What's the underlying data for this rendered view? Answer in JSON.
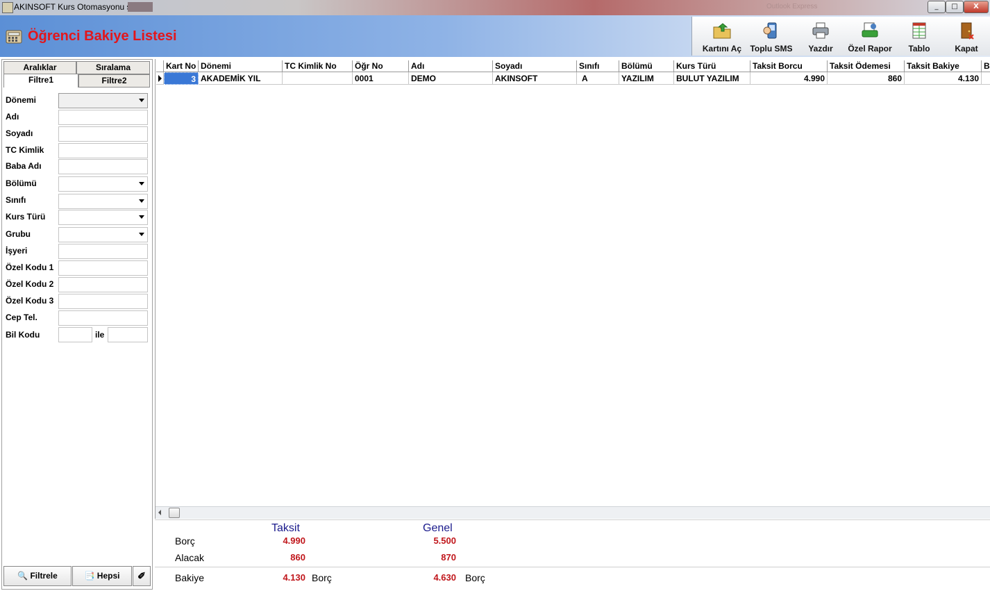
{
  "window": {
    "title": "AKINSOFT Kurs Otomasyonu s",
    "bg_label": "Outlook Express",
    "minimize": "_",
    "maximize": "□",
    "close": "X"
  },
  "header": {
    "title": "Öğrenci Bakiye Listesi",
    "title_color": "#e3161b"
  },
  "toolbar": {
    "items": [
      {
        "label": "Kartını Aç",
        "icon": "folder-open-icon"
      },
      {
        "label": "Toplu SMS",
        "icon": "sms-icon"
      },
      {
        "label": "Yazdır",
        "icon": "printer-icon"
      },
      {
        "label": "Özel Rapor",
        "icon": "report-icon"
      },
      {
        "label": "Tablo",
        "icon": "table-icon"
      },
      {
        "label": "Kapat",
        "icon": "door-exit-icon"
      }
    ]
  },
  "left_panel": {
    "tabs_top": [
      "Aralıklar",
      "Sıralama"
    ],
    "tabs_bottom": [
      "Filtre1",
      "Filtre2"
    ],
    "fields": [
      {
        "label": "Dönemi",
        "type": "combo",
        "value": ""
      },
      {
        "label": "Adı",
        "type": "text",
        "value": ""
      },
      {
        "label": "Soyadı",
        "type": "text",
        "value": ""
      },
      {
        "label": "TC Kimlik",
        "type": "text",
        "value": ""
      },
      {
        "label": "Baba Adı",
        "type": "text",
        "value": ""
      },
      {
        "label": "Bölümü",
        "type": "combo",
        "value": ""
      },
      {
        "label": "Sınıfı",
        "type": "combo",
        "value": ""
      },
      {
        "label": "Kurs Türü",
        "type": "combo",
        "value": ""
      },
      {
        "label": "Grubu",
        "type": "combo",
        "value": ""
      },
      {
        "label": "İşyeri",
        "type": "text",
        "value": ""
      },
      {
        "label": "Özel Kodu 1",
        "type": "text",
        "value": ""
      },
      {
        "label": "Özel Kodu 2",
        "type": "text",
        "value": ""
      },
      {
        "label": "Özel Kodu 3",
        "type": "text",
        "value": ""
      },
      {
        "label": "Cep Tel.",
        "type": "text",
        "value": ""
      },
      {
        "label": "Bil Kodu",
        "type": "range",
        "value": ""
      }
    ],
    "range_separator": "ile",
    "buttons": {
      "filter": "Filtrele",
      "all": "Hepsi"
    }
  },
  "grid": {
    "columns": [
      "Kart No",
      "Dönemi",
      "TC Kimlik No",
      "Öğr No",
      "Adı",
      "Soyadı",
      "Sınıfı",
      "Bölümü",
      "Kurs Türü",
      "Taksit Borcu",
      "Taksit Ödemesi",
      "Taksit Bakiye",
      "B"
    ],
    "rows": [
      [
        "3",
        "AKADEMİK YIL",
        "",
        "0001",
        "DEMO",
        "AKINSOFT",
        "A",
        "YAZILIM",
        "BULUT YAZILIM",
        "4.990",
        "860",
        "4.130",
        ""
      ]
    ]
  },
  "summary": {
    "taksit_header": "Taksit",
    "genel_header": "Genel",
    "rows": [
      {
        "label": "Borç",
        "taksit": "4.990",
        "genel": "5.500"
      },
      {
        "label": "Alacak",
        "taksit": "860",
        "genel": "870"
      }
    ],
    "bakiye": {
      "label": "Bakiye",
      "taksit": "4.130",
      "taksit_type": "Borç",
      "genel": "4.630",
      "genel_type": "Borç"
    },
    "value_color": "#c0161b"
  }
}
